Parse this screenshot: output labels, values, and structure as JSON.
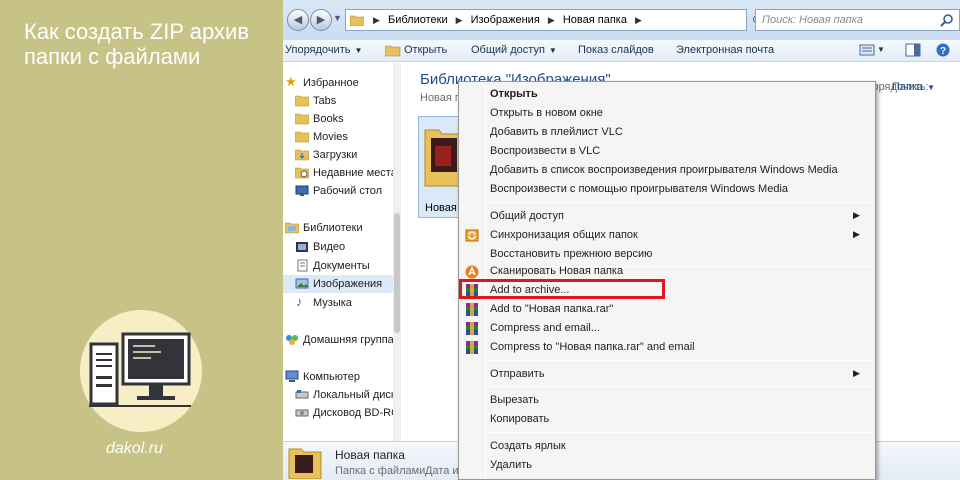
{
  "promo": {
    "title": "Как создать ZIP архив папки с файлами",
    "site": "dakol.ru",
    "accent": "#c7c286"
  },
  "explorer": {
    "breadcrumbs": [
      "Библиотеки",
      "Изображения",
      "Новая папка"
    ],
    "search_placeholder": "Поиск: Новая папка",
    "toolbar": {
      "organize": "Упорядочить",
      "open": "Открыть",
      "share": "Общий доступ",
      "slideshow": "Показ слайдов",
      "email": "Электронная почта"
    },
    "nav": {
      "favorites": "Избранное",
      "fav_items": [
        "Tabs",
        "Books",
        "Movies",
        "Загрузки",
        "Недавние места",
        "Рабочий стол"
      ],
      "libraries": "Библиотеки",
      "lib_items": [
        "Видео",
        "Документы",
        "Изображения",
        "Музыка"
      ],
      "homegroup": "Домашняя группа",
      "computer": "Компьютер",
      "comp_items": [
        "Локальный диск",
        "Дисковод BD-RO"
      ]
    },
    "content": {
      "title": "Библиотека \"Изображения\"",
      "subtitle": "Новая папка",
      "arrange_label": "Упорядочить:",
      "arrange_value": "Папка",
      "tile_label": "Новая папка"
    },
    "details": {
      "name": "Новая папка",
      "type": "Папка с файлами",
      "date_label": "Дата изменения"
    }
  },
  "context_menu": {
    "items": [
      {
        "label": "Открыть",
        "bold": true
      },
      {
        "label": "Открыть в новом окне"
      },
      {
        "label": "Добавить в плейлист VLC"
      },
      {
        "label": "Воспроизвести в VLC"
      },
      {
        "label": "Добавить в список воспроизведения проигрывателя Windows Media"
      },
      {
        "label": "Воспроизвести с помощью проигрывателя Windows Media"
      },
      {
        "label": "Общий доступ",
        "submenu": true
      },
      {
        "label": "Синхронизация общих папок",
        "submenu": true,
        "icon": "sync-icon"
      },
      {
        "label": "Восстановить прежнюю версию"
      },
      {
        "label": "Сканировать Новая папка",
        "icon": "avast-icon"
      },
      {
        "label": "Add to archive...",
        "icon": "winrar-icon",
        "highlighted": true
      },
      {
        "label": "Add to \"Новая папка.rar\"",
        "icon": "winrar-icon"
      },
      {
        "label": "Compress and email...",
        "icon": "winrar-icon"
      },
      {
        "label": "Compress to \"Новая папка.rar\" and email",
        "icon": "winrar-icon"
      },
      {
        "label": "Отправить",
        "submenu": true
      },
      {
        "label": "Вырезать"
      },
      {
        "label": "Копировать"
      },
      {
        "label": "Создать ярлык"
      },
      {
        "label": "Удалить"
      }
    ],
    "highlight_color": "#e0161b"
  }
}
